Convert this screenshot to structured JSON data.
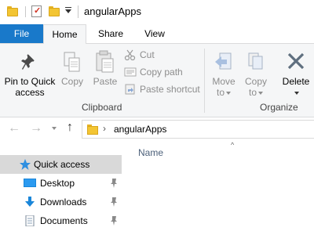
{
  "window": {
    "title": "angularApps"
  },
  "ribbon_tabs": [
    {
      "label": "File"
    },
    {
      "label": "Home"
    },
    {
      "label": "Share"
    },
    {
      "label": "View"
    }
  ],
  "clipboard": {
    "pin_label_line1": "Pin to Quick",
    "pin_label_line2": "access",
    "copy_label": "Copy",
    "paste_label": "Paste",
    "cut_label": "Cut",
    "copy_path_label": "Copy path",
    "paste_shortcut_label": "Paste shortcut",
    "group_label": "Clipboard"
  },
  "organize": {
    "move_label_line1": "Move",
    "move_label_line2": "to",
    "copy_label_line1": "Copy",
    "copy_label_line2": "to",
    "delete_label": "Delete",
    "group_label": "Organize"
  },
  "address": {
    "path_segment": "angularApps"
  },
  "file_list": {
    "column_name": "Name"
  },
  "navigation_pane": {
    "items": [
      {
        "label": "Quick access",
        "selected": true
      },
      {
        "label": "Desktop",
        "pinned": true
      },
      {
        "label": "Downloads",
        "pinned": true
      },
      {
        "label": "Documents",
        "pinned": true
      }
    ]
  },
  "colors": {
    "accent": "#1979ca",
    "folder": "#f3c533",
    "selected_bg": "#d9d9d9"
  }
}
